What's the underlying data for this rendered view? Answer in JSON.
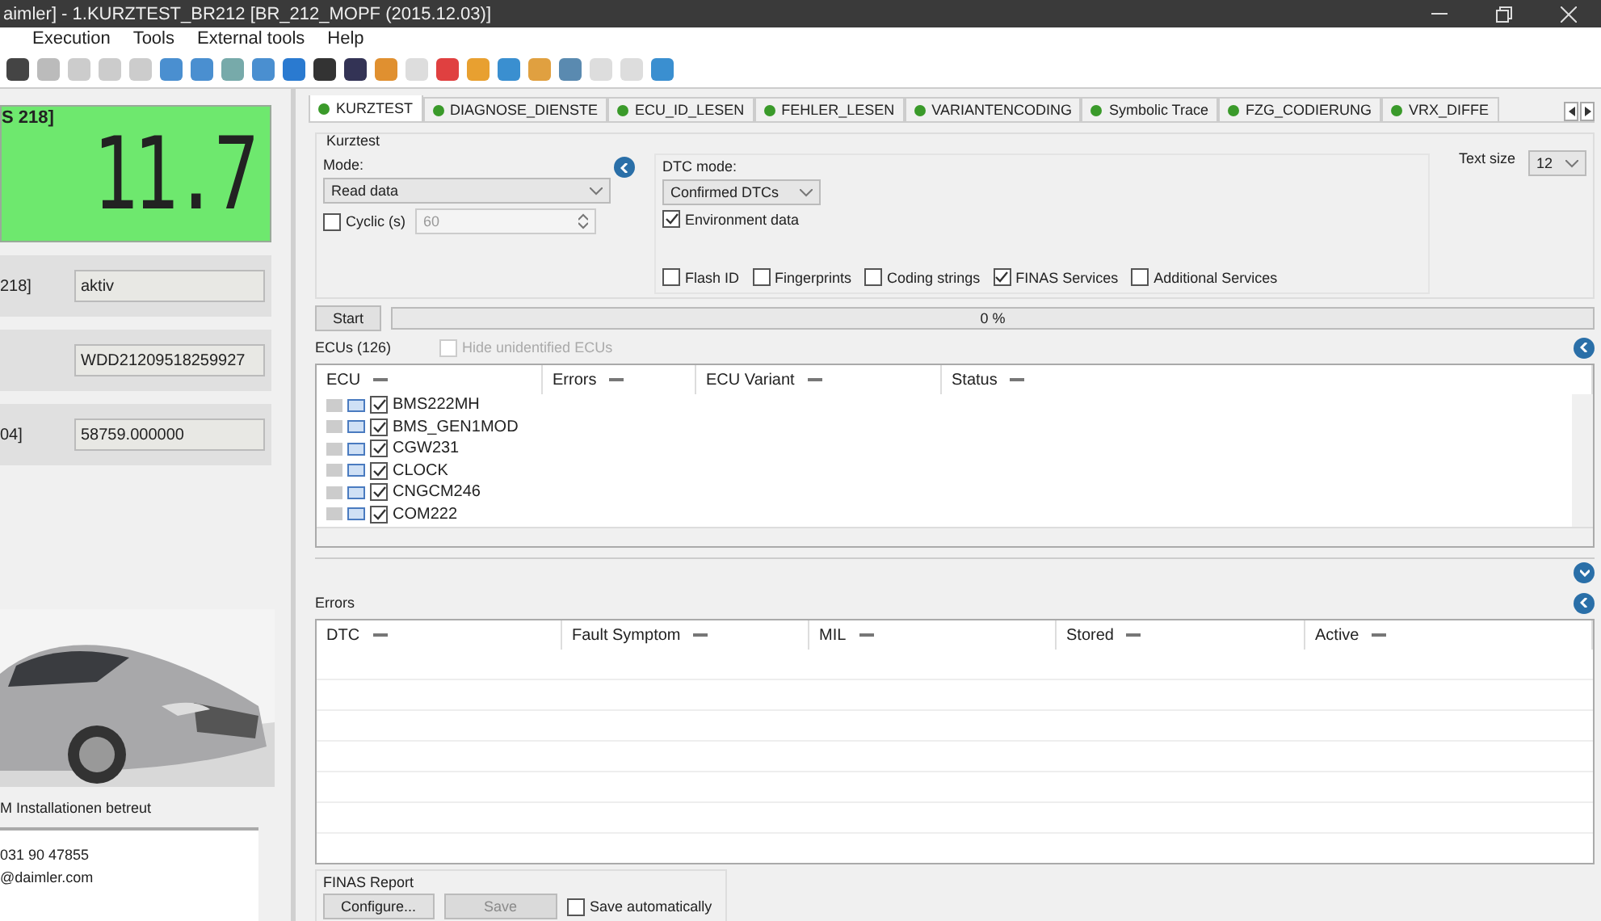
{
  "window": {
    "title": "aimler] - 1.KURZTEST_BR212 [BR_212_MOPF (2015.12.03)]"
  },
  "menu": [
    "Execution",
    "Tools",
    "External tools",
    "Help"
  ],
  "left_panel": {
    "display_label": "S 218]",
    "display_value": "11.7",
    "fields": [
      {
        "label": "218]",
        "value": "aktiv"
      },
      {
        "value": "WDD21209518259927"
      },
      {
        "label": "04]",
        "value": "58759.000000"
      }
    ],
    "support_title": "M Installationen betreut",
    "contact": [
      "031 90 47855",
      "@daimler.com"
    ]
  },
  "tabs": [
    {
      "label": "KURZTEST",
      "selected": true
    },
    {
      "label": "DIAGNOSE_DIENSTE",
      "selected": false
    },
    {
      "label": "ECU_ID_LESEN",
      "selected": false
    },
    {
      "label": "FEHLER_LESEN",
      "selected": false
    },
    {
      "label": "VARIANTENCODING",
      "selected": false
    },
    {
      "label": "Symbolic Trace",
      "selected": false
    },
    {
      "label": "FZG_CODIERUNG",
      "selected": false
    },
    {
      "label": "VRX_DIFFE",
      "selected": false
    }
  ],
  "kurztest": {
    "title": "Kurztest",
    "mode_label": "Mode:",
    "mode": "Read data",
    "cyclic": {
      "label": "Cyclic (s)",
      "checked": false
    },
    "cyclic_value": "60",
    "dtc_mode_label": "DTC mode:",
    "dtc_mode": "Confirmed DTCs",
    "environment": {
      "label": "Environment data",
      "checked": true
    },
    "options": [
      {
        "label": "Flash ID",
        "checked": false
      },
      {
        "label": "Fingerprints",
        "checked": false
      },
      {
        "label": "Coding strings",
        "checked": false
      },
      {
        "label": "FINAS Services",
        "checked": true
      },
      {
        "label": "Additional Services",
        "checked": false
      }
    ],
    "text_size_label": "Text size",
    "text_size": "12"
  },
  "start_button": "Start",
  "progress": {
    "level": 0,
    "reading": "0 %"
  },
  "ecus": {
    "title": "ECUs (126)",
    "hide": {
      "label": "Hide unidentified ECUs",
      "checked": false
    },
    "columns": [
      "ECU",
      "Errors",
      "ECU Variant",
      "Status"
    ],
    "rows": [
      {
        "name": "BMS222MH",
        "checked": true
      },
      {
        "name": "BMS_GEN1MOD",
        "checked": true
      },
      {
        "name": "CGW231",
        "checked": true
      },
      {
        "name": "CLOCK",
        "checked": true
      },
      {
        "name": "CNGCM246",
        "checked": true
      },
      {
        "name": "COM222",
        "checked": true
      }
    ]
  },
  "errors": {
    "title": "Errors",
    "columns": [
      "DTC",
      "Fault Symptom",
      "MIL",
      "Stored",
      "Active"
    ]
  },
  "finas": {
    "title": "FINAS Report",
    "configure": "Configure...",
    "save": "Save",
    "save_disabled": true,
    "auto": {
      "label": "Save automatically",
      "checked": false
    }
  }
}
